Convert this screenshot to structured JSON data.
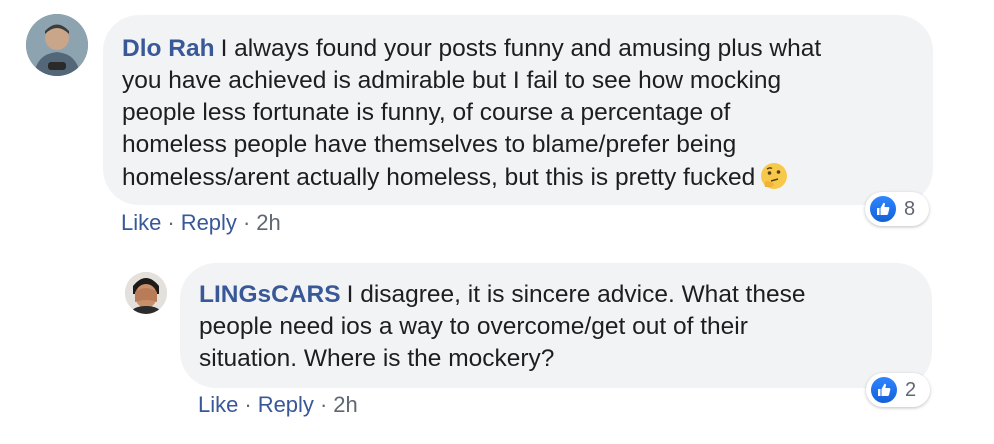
{
  "comments": [
    {
      "author": "Dlo Rah",
      "text": "I always found your posts funny and amusing plus what\nyou have achieved is admirable but I fail to see how mocking\npeople less fortunate is funny, of course a percentage of\nhomeless people have themselves to blame/prefer being\nhomeless/arent actually homeless, but this is pretty fucked",
      "emoji": "thinking-face",
      "like_label": "Like",
      "reply_label": "Reply",
      "separator": "·",
      "time": "2h",
      "reaction_count": "8",
      "reaction_type": "like"
    },
    {
      "author": "LINGsCARS",
      "text": "I disagree, it is sincere advice. What these\npeople need ios a way to overcome/get out of their\nsituation. Where is the mockery?",
      "like_label": "Like",
      "reply_label": "Reply",
      "separator": "·",
      "time": "2h",
      "reaction_count": "2",
      "reaction_type": "like"
    }
  ],
  "colors": {
    "author": "#385898",
    "bubble": "#f2f3f5",
    "like_blue": "#1877f2",
    "text": "#1c1e21",
    "meta": "#606770"
  }
}
